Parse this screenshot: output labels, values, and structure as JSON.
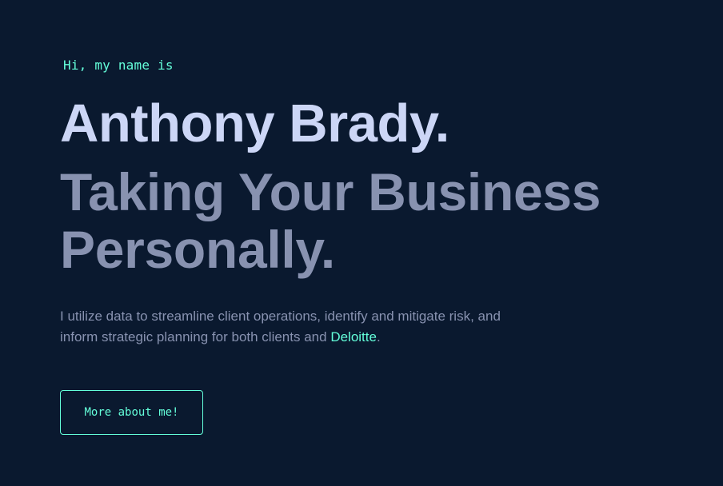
{
  "hero": {
    "intro": "Hi, my name is",
    "name": "Anthony Brady.",
    "tagline": "Taking Your Business Personally.",
    "description": {
      "text": "I utilize data to streamline client operations, identify and mitigate risk, and inform strategic planning for both clients and ",
      "link_text": "Deloitte",
      "suffix": "."
    },
    "cta_label": "More about me!"
  },
  "colors": {
    "background": "#0a192f",
    "accent": "#64ffda",
    "heading": "#ccd6f6",
    "muted": "#8892b0"
  }
}
